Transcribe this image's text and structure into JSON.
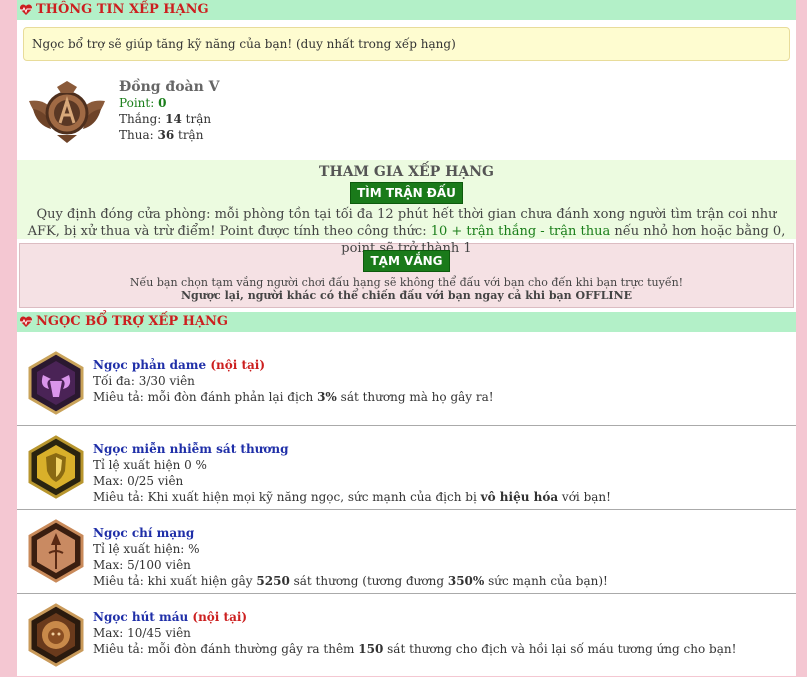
{
  "header": {
    "title": "THÔNG TIN XẾP HẠNG"
  },
  "note": {
    "text": "Ngọc bổ trợ sẽ giúp tăng kỹ năng của bạn! (duy nhất trong xếp hạng)"
  },
  "rank": {
    "name": "Đồng đoàn V",
    "point_label": "Point: ",
    "point_value": "0",
    "wins_label": "Thắng: ",
    "wins_value": "14",
    "wins_unit": " trận",
    "losses_label": "Thua: ",
    "losses_value": "36",
    "losses_unit": " trận"
  },
  "join": {
    "title": "THAM GIA XẾP HẠNG",
    "button": "TÌM TRẬN ĐẤU",
    "rule_a": "Quy định đóng cửa phòng: mỗi phòng tồn tại tối đa 12 phút hết thời gian chưa đánh xong người tìm trận coi như AFK, bị xử thua và trừ điểm! Point được tính theo công thức: ",
    "rule_formula": "10 + trận thắng - trận thua",
    "rule_b": " nếu nhỏ hơn hoặc bằng 0, point sẽ trở thành 1"
  },
  "afk": {
    "button": "TẠM VẮNG",
    "line1": "Nếu bạn chọn tạm vắng người chơi đấu hạng sẽ không thể đấu với bạn cho đến khi bạn trực tuyến!",
    "line2": "Ngược lại, người khác có thể chiến đấu với bạn ngay cả khi bạn OFFLINE"
  },
  "gems_header": {
    "title": "NGỌC BỔ TRỢ XẾP HẠNG"
  },
  "gems": [
    {
      "icon": "ram-head-icon",
      "name": "Ngọc phản dame",
      "tag": " (nội tại)",
      "line1": "Tối đa: 3/30 viên",
      "desc_a": "Miêu tả: mỗi đòn đánh phản lại địch ",
      "desc_bold": "3%",
      "desc_b": " sát thương mà họ gây ra!"
    },
    {
      "icon": "shield-icon",
      "name": "Ngọc miễn nhiễm sát thương",
      "tag": "",
      "line1": "Tỉ lệ xuất hiện 0 %",
      "line2": "Max: 0/25 viên",
      "desc_a": "Miêu tả: Khi xuất hiện mọi kỹ năng ngọc, sức mạnh của địch bị ",
      "desc_bold": "vô hiệu hóa",
      "desc_b": " với bạn!"
    },
    {
      "icon": "spear-icon",
      "name": "Ngọc chí mạng",
      "tag": "",
      "line1": "Tỉ lệ xuất hiện: %",
      "line2": "Max: 5/100 viên",
      "desc_a": "Miêu tả: khi xuất hiện gây ",
      "desc_bold": "5250",
      "desc_b": " sát thương (tương đương ",
      "desc_bold2": "350%",
      "desc_c": " sức mạnh của bạn)!"
    },
    {
      "icon": "lion-head-icon",
      "name": "Ngọc hút máu",
      "tag": " (nội tại)",
      "line1": "Max: 10/45 viên",
      "desc_a": "Miêu tả: mỗi đòn đánh thường gây ra thêm ",
      "desc_bold": "150",
      "desc_b": " sát thương cho địch và hồi lại số máu tương ứng cho bạn!"
    }
  ]
}
